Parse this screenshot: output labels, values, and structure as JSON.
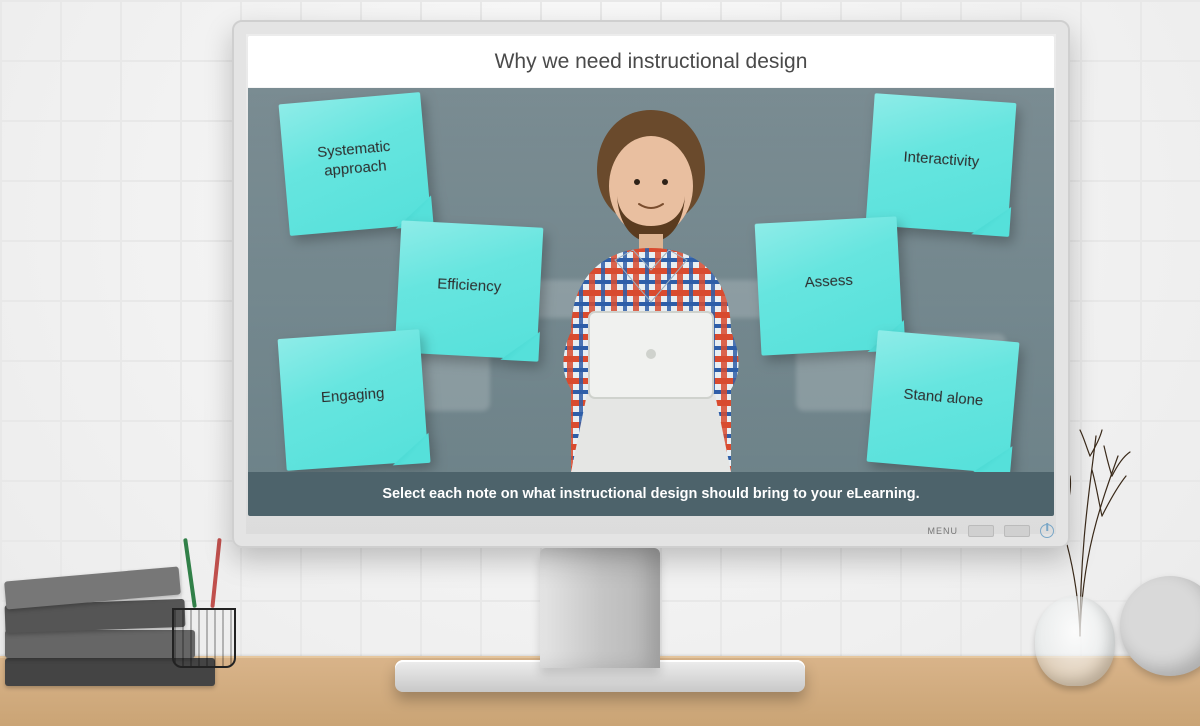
{
  "slide": {
    "title": "Why we need instructional design",
    "instruction": "Select each note on what instructional design should bring to your eLearning.",
    "notes": [
      "Systematic approach",
      "Efficiency",
      "Engaging",
      "Interactivity",
      "Assess",
      "Stand alone"
    ]
  },
  "monitor": {
    "menu_label": "MENU"
  },
  "colors": {
    "sticky": "#66e5df",
    "footer": "#4d636b"
  }
}
